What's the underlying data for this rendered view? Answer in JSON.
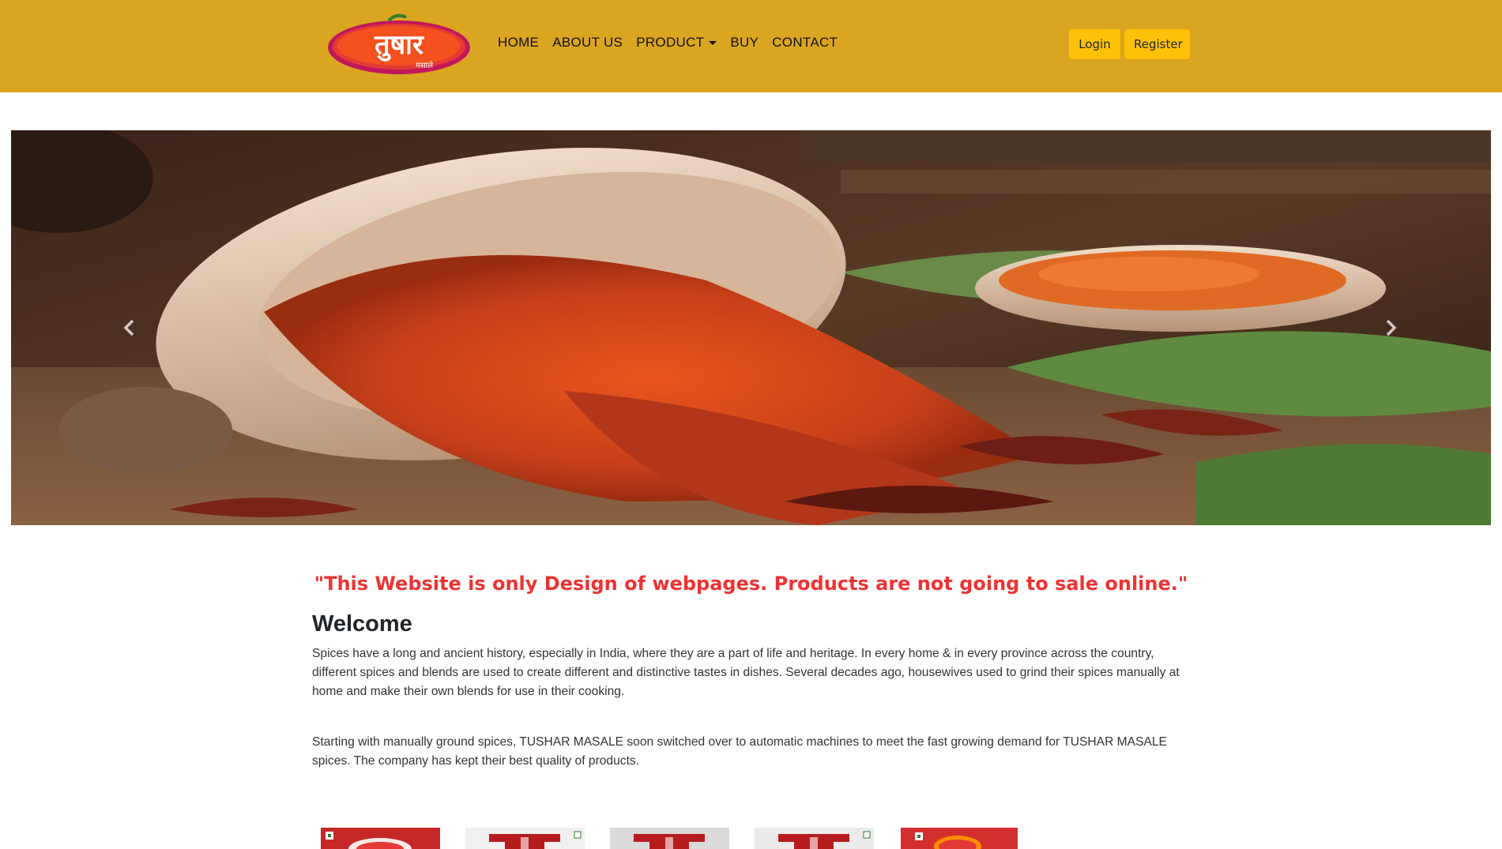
{
  "header": {
    "logo": {
      "text": "तुषार",
      "subtext": "मसाले",
      "alt_icon": "brand-logo"
    },
    "nav": [
      {
        "label": "HOME"
      },
      {
        "label": "ABOUT US"
      },
      {
        "label": "PRODUCT",
        "dropdown": true
      },
      {
        "label": "BUY"
      },
      {
        "label": "CONTACT"
      }
    ],
    "login_label": "Login",
    "register_label": "Register",
    "colors": {
      "header_bg": "#daa520",
      "button_bg": "#ffc107"
    }
  },
  "carousel": {
    "prev_icon": "chevron-left-icon",
    "next_icon": "chevron-right-icon"
  },
  "main": {
    "notice": "\"This Website is only Design of webpages. Products are not going to sale online.\"",
    "notice_color": "#ee3333",
    "title": "Welcome",
    "paragraph1": "Spices have a long and ancient history, especially in India, where they are a part of life and heritage. In every home & in every province across the country, different spices and blends are used to create different and distinctive tastes in dishes. Several decades ago, housewives used to grind their spices manually at home and make their own blends for use in their cooking.",
    "paragraph2": "Starting with manually ground spices, TUSHAR MASALE soon switched over to automatic machines to meet the fast growing demand for TUSHAR MASALE spices. The company has kept their best quality of products."
  },
  "products": [
    {
      "icon": "product-pack-red"
    },
    {
      "icon": "product-pack-white"
    },
    {
      "icon": "product-pack-grey"
    },
    {
      "icon": "product-pack-white"
    },
    {
      "icon": "product-pack-red"
    }
  ]
}
